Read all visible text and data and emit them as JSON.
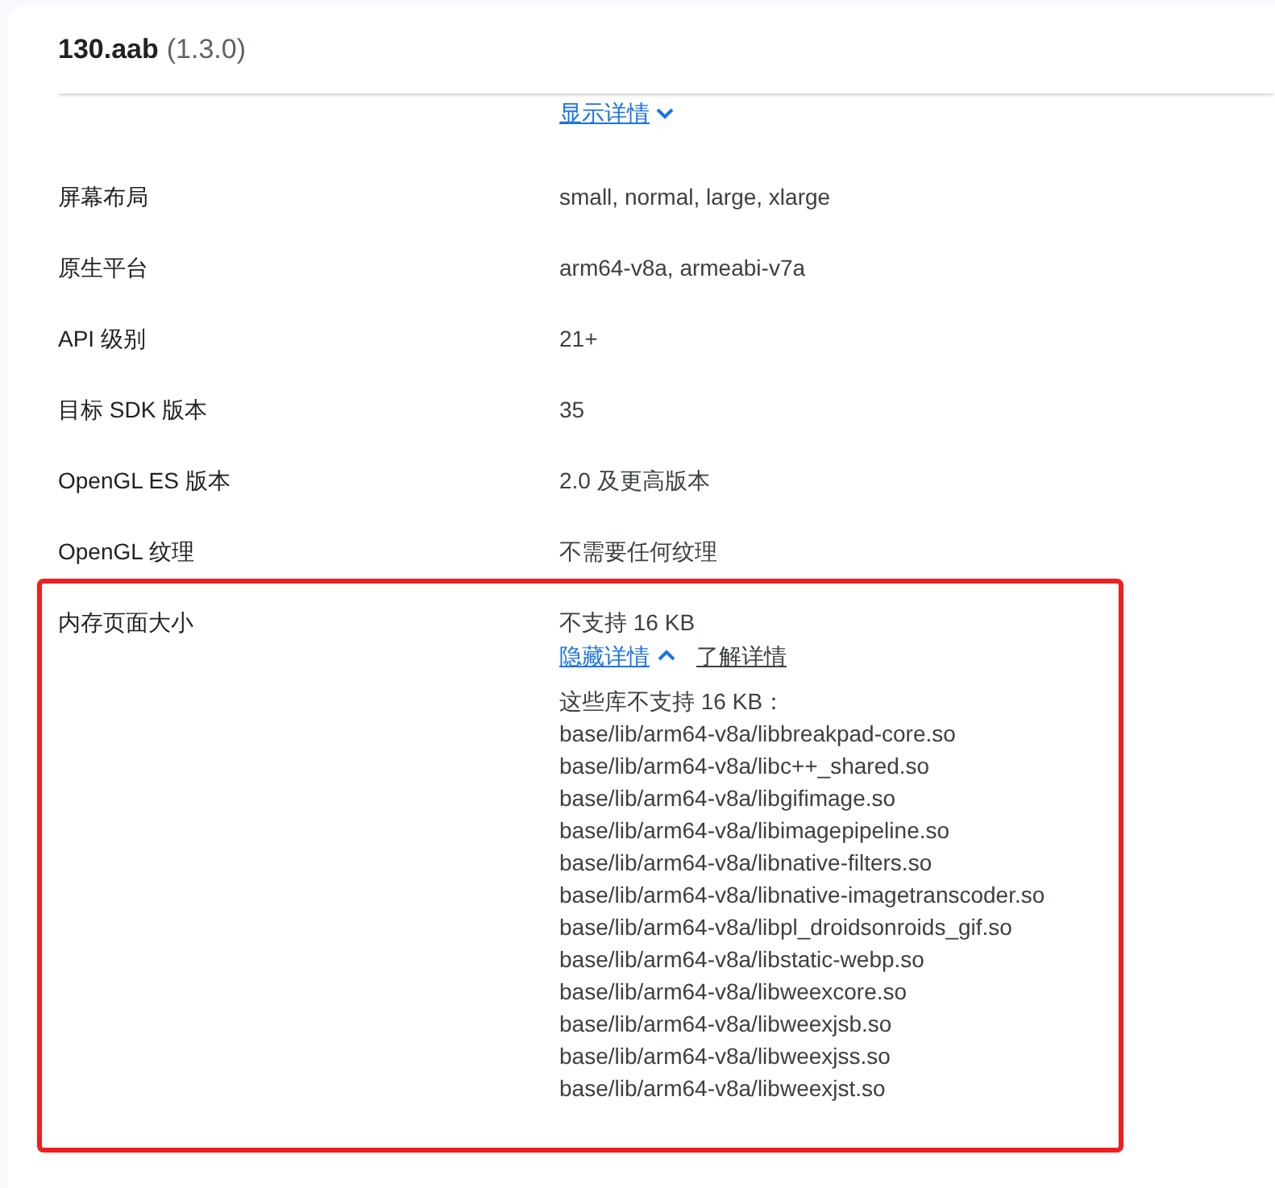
{
  "header": {
    "title": "130.aab",
    "version": "(1.3.0)"
  },
  "top_link": {
    "label": "显示详情",
    "expanded": false
  },
  "rows": [
    {
      "label": "屏幕布局",
      "value": "small, normal, large, xlarge",
      "highlighted": false
    },
    {
      "label": "原生平台",
      "value": "arm64-v8a, armeabi-v7a",
      "highlighted": false
    },
    {
      "label": "API 级别",
      "value": "21+",
      "highlighted": false
    },
    {
      "label": "目标 SDK 版本",
      "value": "35",
      "highlighted": false
    },
    {
      "label": "OpenGL ES 版本",
      "value": "2.0 及更高版本",
      "highlighted": false
    },
    {
      "label": "OpenGL 纹理",
      "value": "不需要任何纹理",
      "highlighted": false
    },
    {
      "label": "内存页面大小",
      "value": "不支持 16 KB",
      "highlighted": true,
      "details": {
        "toggle": "隐藏详情",
        "expanded": true,
        "learn_more": "了解详情",
        "heading": "这些库不支持 16 KB：",
        "items": [
          "base/lib/arm64-v8a/libbreakpad-core.so",
          "base/lib/arm64-v8a/libc++_shared.so",
          "base/lib/arm64-v8a/libgifimage.so",
          "base/lib/arm64-v8a/libimagepipeline.so",
          "base/lib/arm64-v8a/libnative-filters.so",
          "base/lib/arm64-v8a/libnative-imagetranscoder.so",
          "base/lib/arm64-v8a/libpl_droidsonroids_gif.so",
          "base/lib/arm64-v8a/libstatic-webp.so",
          "base/lib/arm64-v8a/libweexcore.so",
          "base/lib/arm64-v8a/libweexjsb.so",
          "base/lib/arm64-v8a/libweexjss.so",
          "base/lib/arm64-v8a/libweexjst.so"
        ]
      }
    }
  ]
}
